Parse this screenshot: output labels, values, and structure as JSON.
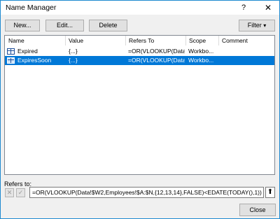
{
  "window": {
    "title": "Name Manager",
    "help_glyph": "?",
    "close_glyph": "✕"
  },
  "toolbar": {
    "new_label": "New...",
    "edit_label": "Edit...",
    "delete_label": "Delete",
    "filter_label": "Filter",
    "filter_glyph": "▾"
  },
  "table": {
    "columns": [
      "Name",
      "Value",
      "Refers To",
      "Scope",
      "Comment"
    ],
    "rows": [
      {
        "name": "Expired",
        "value": "{...}",
        "refers_to": "=OR(VLOOKUP(Data...",
        "scope": "Workbo...",
        "comment": "",
        "selected": false
      },
      {
        "name": "ExpiresSoon",
        "value": "{...}",
        "refers_to": "=OR(VLOOKUP(Data...",
        "scope": "Workbo...",
        "comment": "",
        "selected": true
      }
    ]
  },
  "refers_to": {
    "label": "Refers to:",
    "formula": "=OR(VLOOKUP(Data!$W2,Employees!$A:$N,{12,13,14},FALSE)<EDATE(TODAY(),1))",
    "cancel_glyph": "✕",
    "enter_glyph": "✓",
    "collapse_glyph": "⬆"
  },
  "footer": {
    "close_label": "Close"
  },
  "colors": {
    "selection": "#0078d7",
    "window_border": "#1e8ad0"
  }
}
